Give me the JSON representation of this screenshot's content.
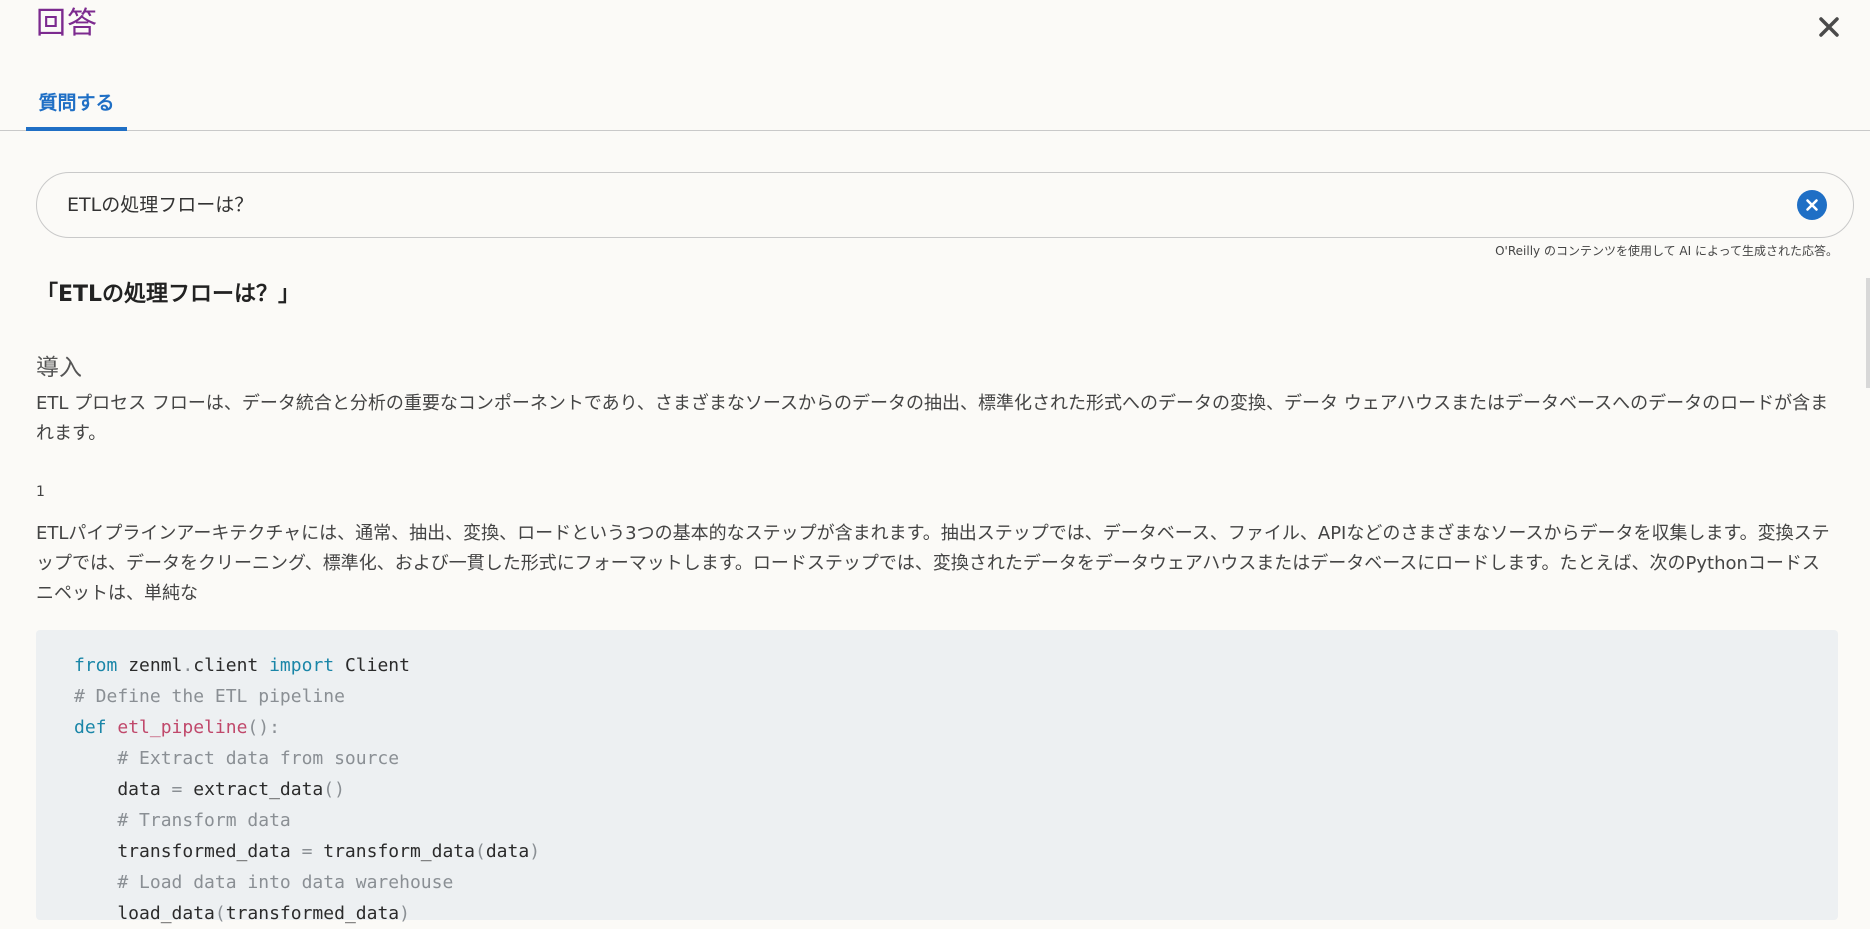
{
  "header": {
    "title": "回答",
    "close_icon": "close-icon"
  },
  "tabs": [
    {
      "label": "質問する",
      "active": true
    }
  ],
  "search": {
    "value": "ETLの処理フローは？",
    "clear_icon": "clear-circle-icon"
  },
  "ai_note": "O'Reilly のコンテンツを使用して AI によって生成された応答。",
  "answer": {
    "question_title": "「ETLの処理フローは？」",
    "section_heading": "導入",
    "paragraph1": "ETL プロセス フローは、データ統合と分析の重要なコンポーネントであり、さまざまなソースからのデータの抽出、標準化された形式へのデータの変換、データ ウェアハウスまたはデータベースへのデータのロードが含まれます。",
    "ref_number": "1",
    "paragraph2": "ETLパイプラインアーキテクチャには、通常、抽出、変換、ロードという3つの基本的なステップが含まれます。抽出ステップでは、データベース、ファイル、APIなどのさまざまなソースからデータを収集します。変換ステップでは、データをクリーニング、標準化、および一貫した形式にフォーマットします。ロードステップでは、変換されたデータをデータウェアハウスまたはデータベースにロードします。たとえば、次のPythonコードスニペットは、単純な"
  },
  "code": {
    "line1": {
      "kw1": "from",
      "mod": " zenml",
      "dot": ".",
      "mod2": "client ",
      "kw2": "import",
      "name": " Client"
    },
    "line2": "# Define the ETL pipeline",
    "line3": {
      "kw": "def",
      "fn": "etl_pipeline",
      "rest": "():"
    },
    "line4": "    # Extract data from source",
    "line5": {
      "lhs": "    data ",
      "op": "=",
      "rhs": " extract_data",
      "paren": "()"
    },
    "line6": "    # Transform data",
    "line7": {
      "lhs": "    transformed_data ",
      "op": "=",
      "rhs": " transform_data",
      "p1": "(",
      "arg": "data",
      "p2": ")"
    },
    "line8": "    # Load data into data warehouse",
    "line9": {
      "lhs": "    load_data",
      "p1": "(",
      "arg": "transformed_data",
      "p2": ")"
    }
  }
}
